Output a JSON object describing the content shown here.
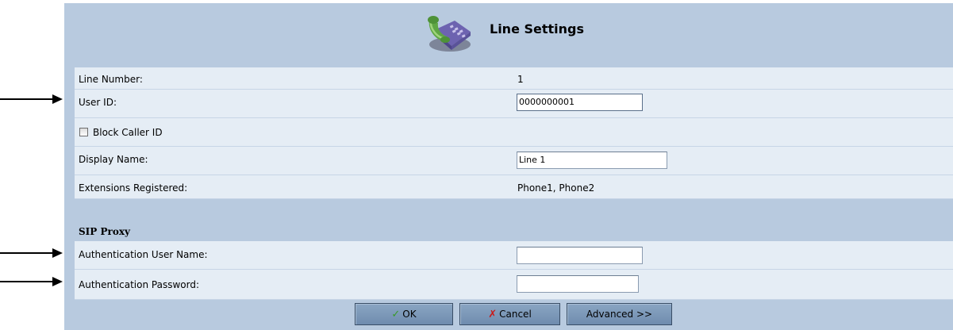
{
  "header": {
    "title": "Line Settings",
    "icon": "phone-icon"
  },
  "fields": {
    "line_number": {
      "label": "Line Number:",
      "value": "1"
    },
    "user_id": {
      "label": "User ID:",
      "value": "0000000001"
    },
    "block_caller_id": {
      "label": "Block Caller ID",
      "checked": false
    },
    "display_name": {
      "label": "Display Name:",
      "value": "Line 1"
    },
    "extensions_registered": {
      "label": "Extensions Registered:",
      "value": "Phone1, Phone2"
    }
  },
  "sip_proxy": {
    "title": "SIP Proxy",
    "auth_user_name": {
      "label": "Authentication User Name:",
      "value": ""
    },
    "auth_password": {
      "label": "Authentication Password:",
      "value": ""
    }
  },
  "buttons": {
    "ok": {
      "label": "OK",
      "icon": "check-icon"
    },
    "cancel": {
      "label": "Cancel",
      "icon": "x-icon"
    },
    "advanced": {
      "label": "Advanced >>"
    }
  },
  "colors": {
    "panel": "#b8cadf",
    "row": "#e5edf5",
    "button": "#7994b5",
    "ok_check": "#3a9a2a",
    "cancel_x": "#c81a1a"
  }
}
